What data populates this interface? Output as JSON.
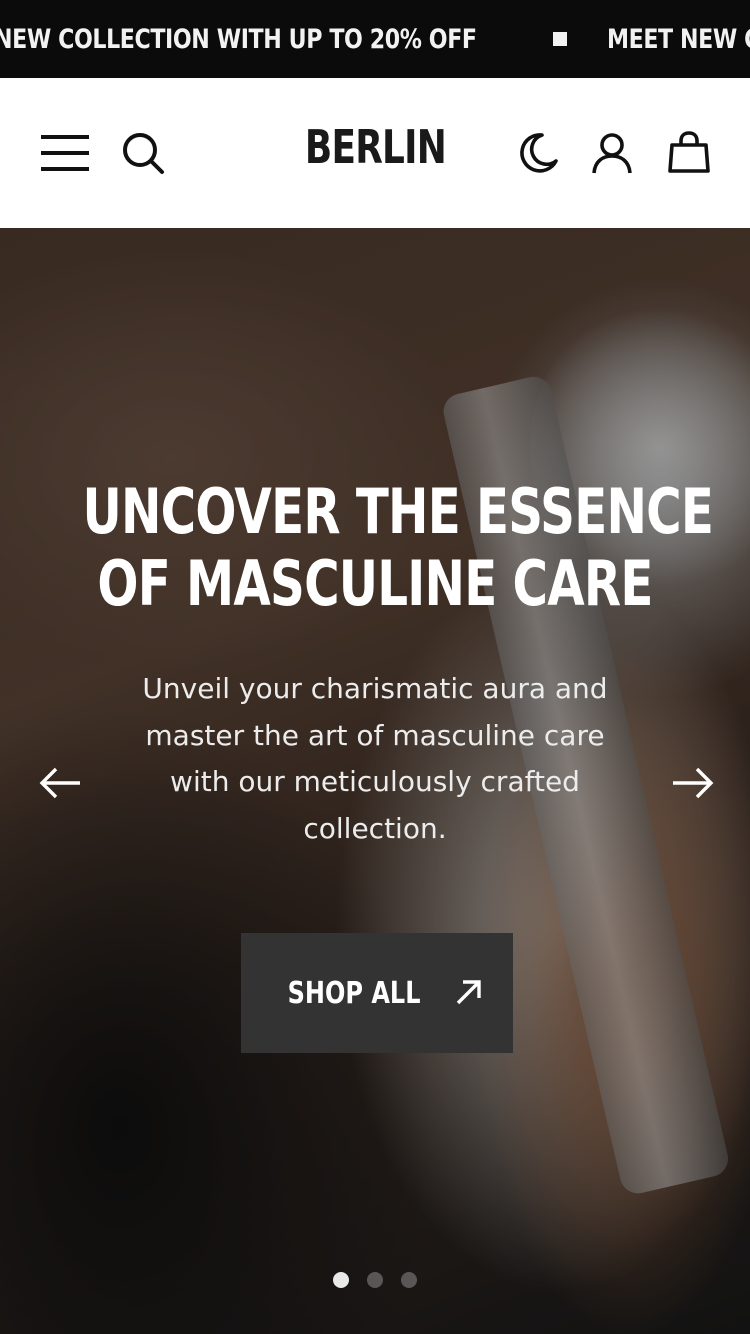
{
  "announcement": {
    "messages": [
      "NEW COLLECTION WITH UP TO 20% OFF",
      "MEET NEW COLLECTION"
    ]
  },
  "header": {
    "logo": "BERLIN",
    "icons": [
      "menu-icon",
      "search-icon",
      "moon-icon",
      "user-icon",
      "bag-icon"
    ]
  },
  "hero": {
    "title_line1": "UNCOVER THE ESSENCE",
    "title_line2": "OF MASCULINE CARE",
    "subtitle": "Unveil your charismatic aura and master the art of masculine care with our meticulously crafted collection.",
    "cta_label": "SHOP ALL",
    "slide_count": 3,
    "active_slide": 1
  },
  "colors": {
    "announcement_bg": "#0b0b0b",
    "header_bg": "#ffffff",
    "cta_bg": "#333333",
    "text_light": "#ffffff"
  }
}
